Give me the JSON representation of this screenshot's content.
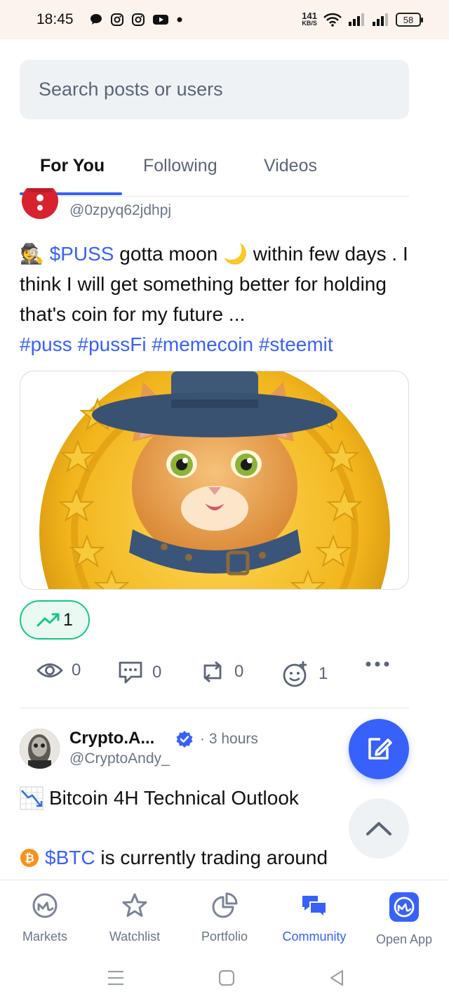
{
  "status_bar": {
    "time": "18:45",
    "net_speed_value": "141",
    "net_speed_unit": "KB/S",
    "battery": "58"
  },
  "search": {
    "placeholder": "Search posts or users"
  },
  "tabs": [
    {
      "label": "For You",
      "active": true
    },
    {
      "label": "Following",
      "active": false
    },
    {
      "label": "Videos",
      "active": false
    }
  ],
  "post1": {
    "handle": "@0zpyq62jdhpj",
    "text_emoji_lead": "🕵",
    "ticker": "$PUSS",
    "text_part1": " gotta moon ",
    "moon_emoji": "🌙",
    "text_part2": " within few days . I think I will get something better for holding that's coin for my future ...",
    "hashtags": [
      "#puss",
      "#pussFi",
      "#memecoin",
      "#steemit"
    ],
    "trend_count": "1",
    "actions": {
      "views": "0",
      "comments": "0",
      "reposts": "0",
      "reactions": "1"
    }
  },
  "post2": {
    "name": "Crypto.A...",
    "time": "· 3 hours",
    "handle": "@CryptoAndy_",
    "title": "Bitcoin 4H Technical Outlook",
    "ticker": "$BTC",
    "line_rest": " is currently trading around"
  },
  "bottom_nav": [
    {
      "label": "Markets",
      "icon": "markets-icon",
      "active": false
    },
    {
      "label": "Watchlist",
      "icon": "star-icon",
      "active": false
    },
    {
      "label": "Portfolio",
      "icon": "pie-chart-icon",
      "active": false
    },
    {
      "label": "Community",
      "icon": "chat-icon",
      "active": true
    },
    {
      "label": "Open App",
      "icon": "app-logo-icon",
      "active": false
    }
  ],
  "colors": {
    "accent": "#3861fb",
    "green": "#16c784",
    "muted": "#6b7588"
  }
}
